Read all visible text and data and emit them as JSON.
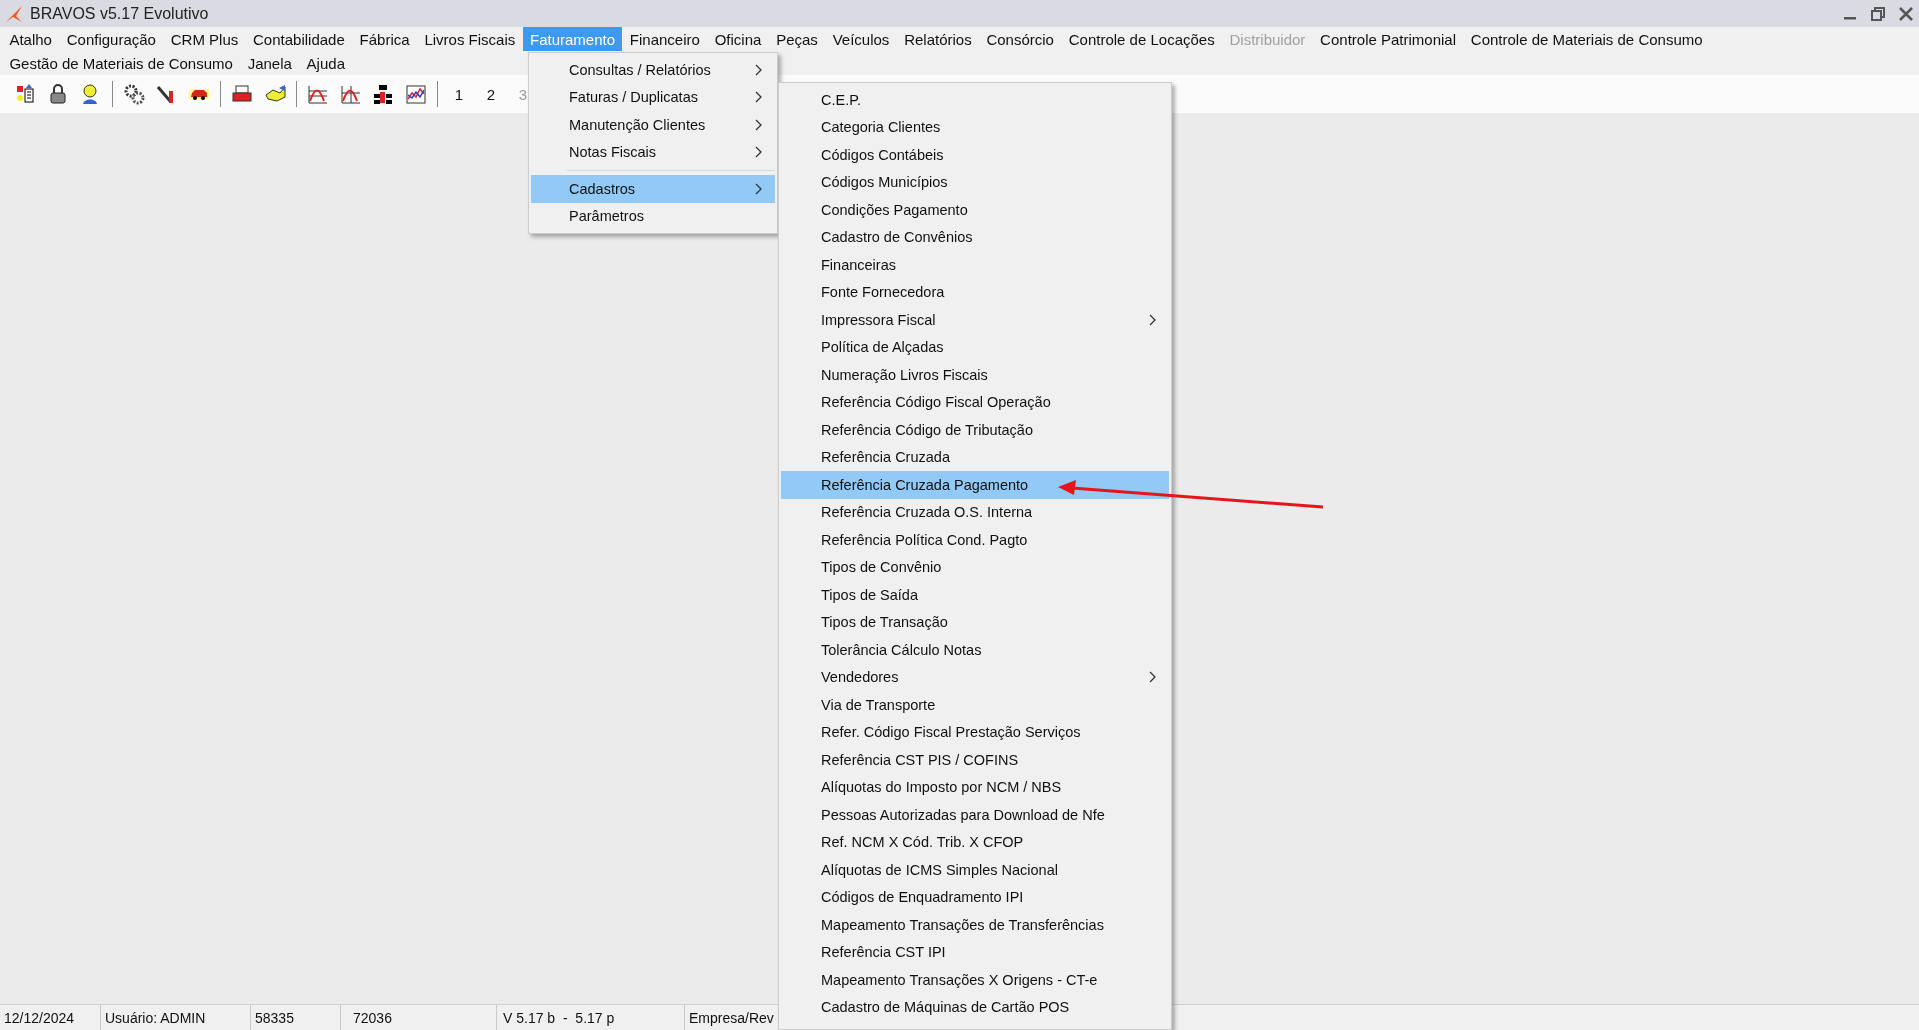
{
  "window": {
    "title": "BRAVOS v5.17 Evolutivo"
  },
  "menu_bar": {
    "first_line": [
      {
        "label": "Atalho",
        "selected": false,
        "disabled": false
      },
      {
        "label": "Configuração",
        "selected": false,
        "disabled": false
      },
      {
        "label": "CRM Plus",
        "selected": false,
        "disabled": false
      },
      {
        "label": "Contabilidade",
        "selected": false,
        "disabled": false
      },
      {
        "label": "Fábrica",
        "selected": false,
        "disabled": false
      },
      {
        "label": "Livros Fiscais",
        "selected": false,
        "disabled": false
      },
      {
        "label": "Faturamento",
        "selected": true,
        "disabled": false
      },
      {
        "label": "Financeiro",
        "selected": false,
        "disabled": false
      },
      {
        "label": "Oficina",
        "selected": false,
        "disabled": false
      },
      {
        "label": "Peças",
        "selected": false,
        "disabled": false
      },
      {
        "label": "Veículos",
        "selected": false,
        "disabled": false
      },
      {
        "label": "Relatórios",
        "selected": false,
        "disabled": false
      },
      {
        "label": "Consórcio",
        "selected": false,
        "disabled": false
      },
      {
        "label": "Controle de Locações",
        "selected": false,
        "disabled": false
      },
      {
        "label": "Distribuidor",
        "selected": false,
        "disabled": true
      },
      {
        "label": "Controle Patrimonial",
        "selected": false,
        "disabled": false
      },
      {
        "label": "Controle de Materiais de Consumo",
        "selected": false,
        "disabled": false
      }
    ],
    "second_line": [
      {
        "label": "Gestão de Materiais de Consumo",
        "selected": false,
        "disabled": false
      },
      {
        "label": "Janela",
        "selected": false,
        "disabled": false
      },
      {
        "label": "Ajuda",
        "selected": false,
        "disabled": false
      }
    ]
  },
  "toolbar": {
    "number_buttons": [
      {
        "label": "1",
        "disabled": false
      },
      {
        "label": "2",
        "disabled": false
      },
      {
        "label": "3",
        "disabled": true
      }
    ]
  },
  "faturamento_menu": {
    "items": [
      {
        "kind": "item",
        "label": "Consultas / Relatórios",
        "has_submenu": true,
        "selected": false
      },
      {
        "kind": "item",
        "label": "Faturas / Duplicatas",
        "has_submenu": true,
        "selected": false
      },
      {
        "kind": "item",
        "label": "Manutenção Clientes",
        "has_submenu": true,
        "selected": false
      },
      {
        "kind": "item",
        "label": "Notas Fiscais",
        "has_submenu": true,
        "selected": false
      },
      {
        "kind": "separator"
      },
      {
        "kind": "item",
        "label": "Cadastros",
        "has_submenu": true,
        "selected": true
      },
      {
        "kind": "item",
        "label": "Parâmetros",
        "has_submenu": false,
        "selected": false
      }
    ]
  },
  "cadastros_submenu": {
    "items": [
      {
        "kind": "item",
        "label": "C.E.P.",
        "has_submenu": false,
        "selected": false
      },
      {
        "kind": "item",
        "label": "Categoria Clientes",
        "has_submenu": false,
        "selected": false
      },
      {
        "kind": "item",
        "label": "Códigos Contábeis",
        "has_submenu": false,
        "selected": false
      },
      {
        "kind": "item",
        "label": "Códigos Municípios",
        "has_submenu": false,
        "selected": false
      },
      {
        "kind": "item",
        "label": "Condições Pagamento",
        "has_submenu": false,
        "selected": false
      },
      {
        "kind": "item",
        "label": "Cadastro de Convênios",
        "has_submenu": false,
        "selected": false
      },
      {
        "kind": "item",
        "label": "Financeiras",
        "has_submenu": false,
        "selected": false
      },
      {
        "kind": "item",
        "label": "Fonte Fornecedora",
        "has_submenu": false,
        "selected": false
      },
      {
        "kind": "item",
        "label": "Impressora Fiscal",
        "has_submenu": true,
        "selected": false
      },
      {
        "kind": "item",
        "label": "Política de Alçadas",
        "has_submenu": false,
        "selected": false
      },
      {
        "kind": "item",
        "label": "Numeração Livros Fiscais",
        "has_submenu": false,
        "selected": false
      },
      {
        "kind": "item",
        "label": "Referência Código Fiscal Operação",
        "has_submenu": false,
        "selected": false
      },
      {
        "kind": "item",
        "label": "Referência Código de Tributação",
        "has_submenu": false,
        "selected": false
      },
      {
        "kind": "item",
        "label": "Referência Cruzada",
        "has_submenu": false,
        "selected": false
      },
      {
        "kind": "item",
        "label": "Referência Cruzada Pagamento",
        "has_submenu": false,
        "selected": true
      },
      {
        "kind": "item",
        "label": "Referência Cruzada O.S. Interna",
        "has_submenu": false,
        "selected": false
      },
      {
        "kind": "item",
        "label": "Referência Política Cond. Pagto",
        "has_submenu": false,
        "selected": false
      },
      {
        "kind": "item",
        "label": "Tipos de Convênio",
        "has_submenu": false,
        "selected": false
      },
      {
        "kind": "item",
        "label": "Tipos de Saída",
        "has_submenu": false,
        "selected": false
      },
      {
        "kind": "item",
        "label": "Tipos de Transação",
        "has_submenu": false,
        "selected": false
      },
      {
        "kind": "item",
        "label": "Tolerância Cálculo Notas",
        "has_submenu": false,
        "selected": false
      },
      {
        "kind": "item",
        "label": "Vendedores",
        "has_submenu": true,
        "selected": false
      },
      {
        "kind": "item",
        "label": "Via de Transporte",
        "has_submenu": false,
        "selected": false
      },
      {
        "kind": "item",
        "label": "Refer. Código Fiscal Prestação Serviços",
        "has_submenu": false,
        "selected": false
      },
      {
        "kind": "item",
        "label": "Referência CST PIS / COFINS",
        "has_submenu": false,
        "selected": false
      },
      {
        "kind": "item",
        "label": "Alíquotas do Imposto por NCM / NBS",
        "has_submenu": false,
        "selected": false
      },
      {
        "kind": "item",
        "label": "Pessoas Autorizadas para Download de Nfe",
        "has_submenu": false,
        "selected": false
      },
      {
        "kind": "item",
        "label": "Ref. NCM X Cód. Trib. X CFOP",
        "has_submenu": false,
        "selected": false
      },
      {
        "kind": "item",
        "label": "Alíquotas de ICMS Simples Nacional",
        "has_submenu": false,
        "selected": false
      },
      {
        "kind": "item",
        "label": "Códigos de Enquadramento IPI",
        "has_submenu": false,
        "selected": false
      },
      {
        "kind": "item",
        "label": "Mapeamento Transações de Transferências",
        "has_submenu": false,
        "selected": false
      },
      {
        "kind": "item",
        "label": "Referência CST IPI",
        "has_submenu": false,
        "selected": false
      },
      {
        "kind": "item",
        "label": "Mapeamento Transações X Origens - CT-e",
        "has_submenu": false,
        "selected": false
      },
      {
        "kind": "item",
        "label": "Cadastro de Máquinas de Cartão POS",
        "has_submenu": false,
        "selected": false
      }
    ]
  },
  "status_bar": {
    "cells": [
      "12/12/2024",
      "Usuário: ADMIN",
      "58335",
      "72036",
      "V 5.17 b  -  5.17 p",
      "Empresa/Rev"
    ]
  }
}
